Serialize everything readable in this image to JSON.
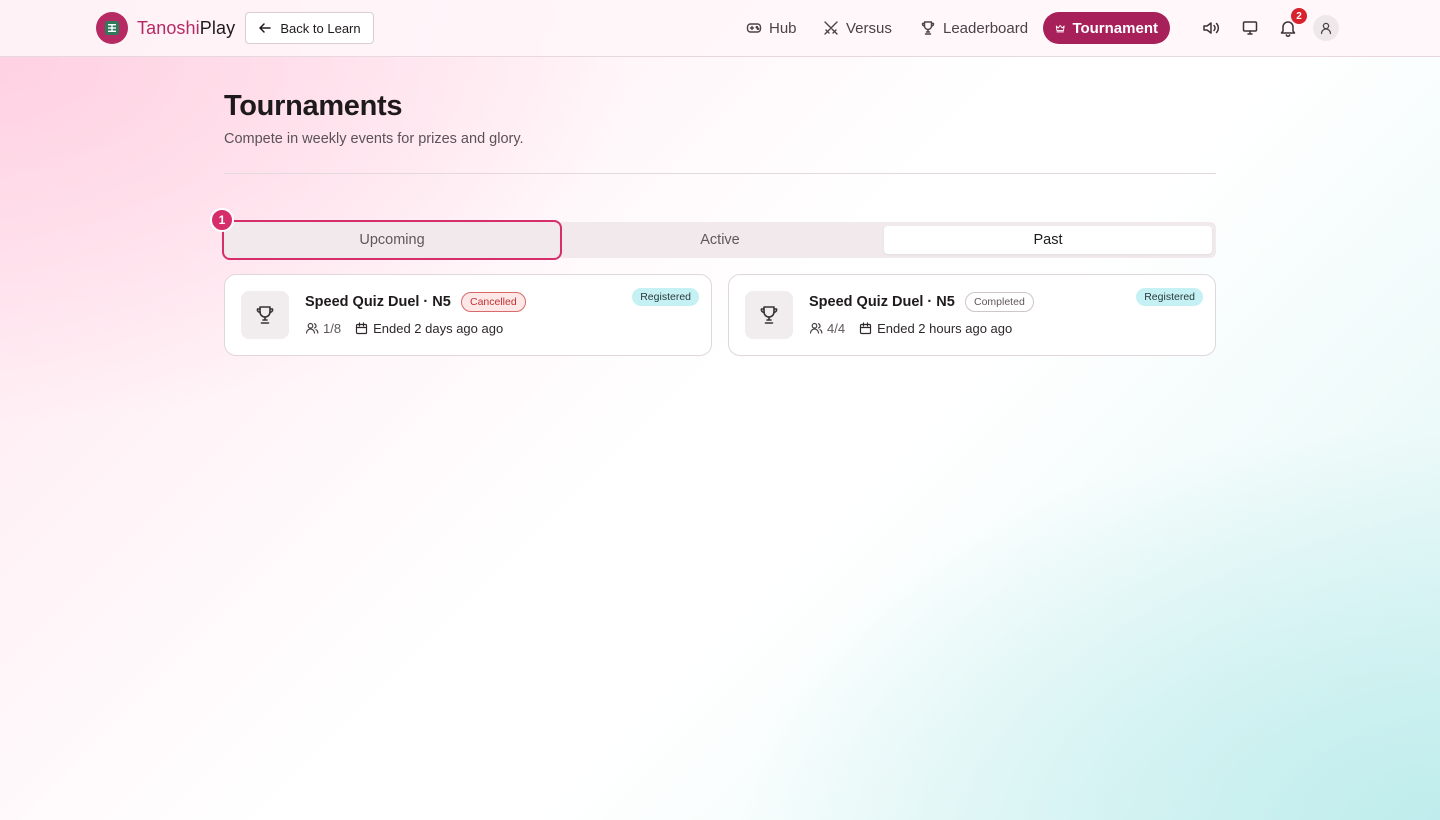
{
  "app": {
    "logo_prefix": "Tanoshi",
    "logo_suffix": "Play",
    "back_label": "Back to Learn"
  },
  "nav": {
    "hub": "Hub",
    "versus": "Versus",
    "leaderboard": "Leaderboard",
    "tournament": "Tournament"
  },
  "header": {
    "notification_count": "2"
  },
  "page": {
    "title": "Tournaments",
    "subtitle": "Compete in weekly events for prizes and glory."
  },
  "tabs": {
    "upcoming": "Upcoming",
    "active": "Active",
    "past": "Past",
    "selected": "Past"
  },
  "step_marker": "1",
  "cards": [
    {
      "title": "Speed Quiz Duel · N5",
      "status": "Cancelled",
      "registration": "Registered",
      "participants": "1/8",
      "ended": "Ended 2 days ago ago"
    },
    {
      "title": "Speed Quiz Duel · N5",
      "status": "Completed",
      "registration": "Registered",
      "participants": "4/4",
      "ended": "Ended 2 hours ago ago"
    }
  ],
  "colors": {
    "brand": "#a8205a",
    "highlight": "#d62e6b",
    "badge": "#d8232f",
    "registered": "#c6f1f4"
  }
}
